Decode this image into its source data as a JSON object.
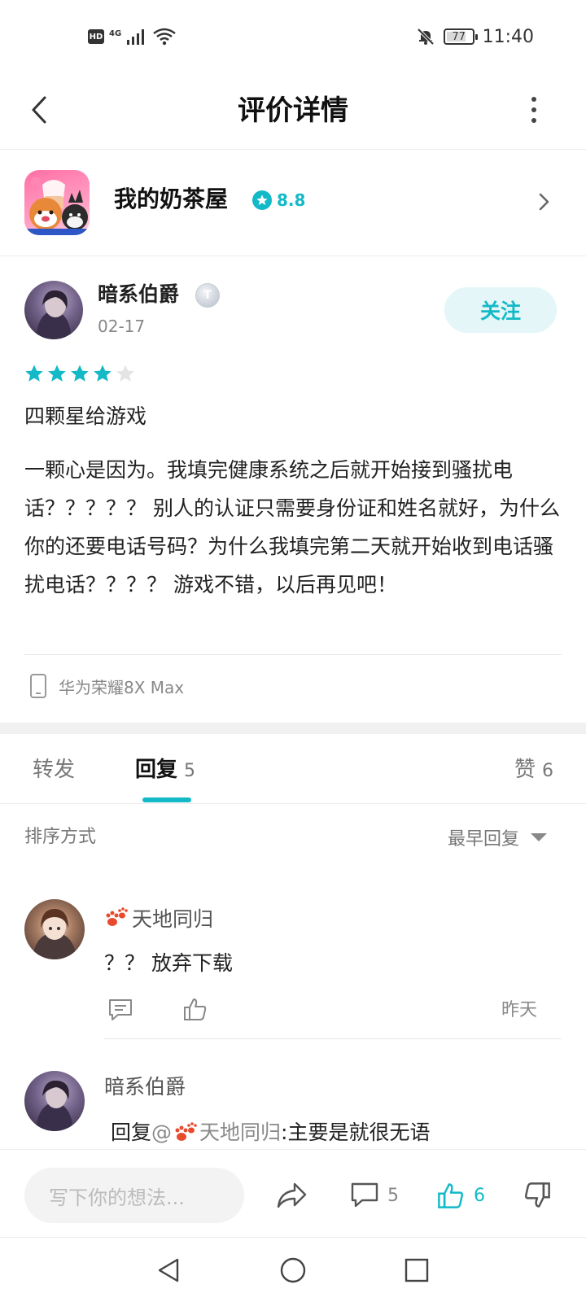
{
  "status_bar": {
    "hd": "HD",
    "network": "4G",
    "battery": "77",
    "battery_level": 0.77,
    "time": "11:40"
  },
  "header": {
    "title": "评价详情",
    "icons": [
      "back-arrow-icon",
      "more-vertical-icon"
    ]
  },
  "game": {
    "name": "我的奶茶屋",
    "score": "8.8",
    "icons": [
      "star-badge-icon",
      "chevron-right-icon"
    ]
  },
  "review": {
    "author": "暗系伯爵",
    "level_badge": "T",
    "date": "02-17",
    "follow_label": "关注",
    "rating": 4,
    "rating_max": 5,
    "headline": "四颗星给游戏",
    "body": "一颗心是因为。我填完健康系统之后就开始接到骚扰电话？？？？？ 别人的认证只需要身份证和姓名就好，为什么你的还要电话号码？为什么我填完第二天就开始收到电话骚扰电话？？？？ 游戏不错，以后再见吧！",
    "device": "华为荣耀8X Max"
  },
  "tabs": {
    "forward": "转发",
    "reply": "回复",
    "reply_count": "5",
    "like": "赞",
    "like_count": "6"
  },
  "sort": {
    "label": "排序方式",
    "value": "最早回复"
  },
  "comments": [
    {
      "author": "天地同归",
      "text": "？？ 放弃下载",
      "time": "昨天"
    },
    {
      "author": "暗系伯爵",
      "reply_prefix": "回复 ",
      "mention": "@",
      "mention_name": "天地同归",
      "text": ":主要是就很无语"
    }
  ],
  "action_bar": {
    "placeholder": "写下你的想法...",
    "comment_count": "5",
    "like_count": "6"
  },
  "colors": {
    "accent": "#14b9c8",
    "text_primary": "#222222",
    "text_secondary": "#888888"
  }
}
